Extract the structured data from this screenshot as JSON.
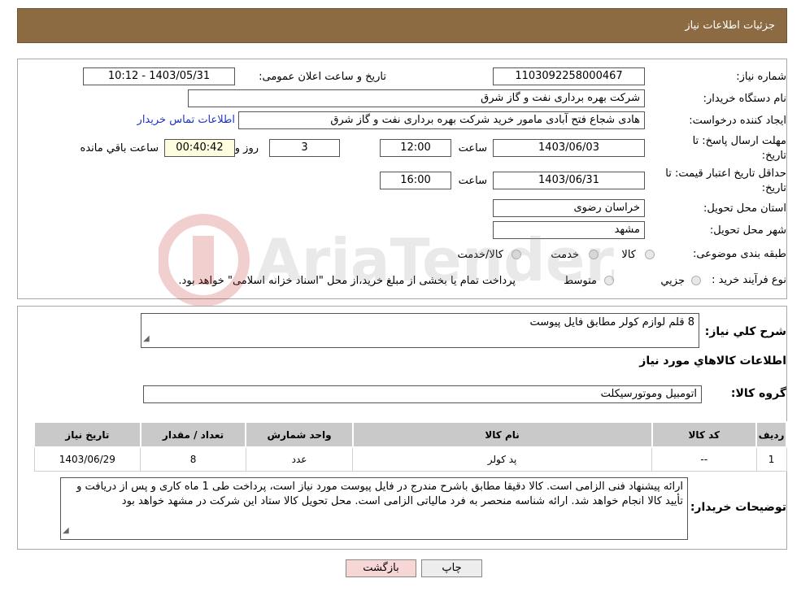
{
  "header": {
    "title": "جزئیات اطلاعات نیاز"
  },
  "form": {
    "need_number_label": "شماره نیاز:",
    "need_number": "1103092258000467",
    "announce_label": "تاریخ و ساعت اعلان عمومی:",
    "announce_value": "1403/05/31 - 10:12",
    "buyer_org_label": "نام دستگاه خریدار:",
    "buyer_org": "شرکت بهره برداری نفت و گاز شرق",
    "creator_label": "ایجاد کننده درخواست:",
    "creator": "هادی شجاع فتح آبادی مامور خرید شرکت بهره برداری نفت و گاز شرق",
    "contact_link": "اطلاعات تماس خریدار",
    "deadline_label_1": "مهلت ارسال پاسخ: تا",
    "deadline_label_2": "تاریخ:",
    "deadline_date": "1403/06/03",
    "time_word": "ساعت",
    "deadline_time": "12:00",
    "days_value": "3",
    "days_word": "روز و",
    "remaining_time": "00:40:42",
    "remaining_word": "ساعت باقي مانده",
    "validity_label_1": "حداقل تاریخ اعتبار قیمت: تا",
    "validity_label_2": "تاریخ:",
    "validity_date": "1403/06/31",
    "validity_time": "16:00",
    "province_label": "استان محل تحویل:",
    "province": "خراسان رضوی",
    "city_label": "شهر محل تحویل:",
    "city": "مشهد",
    "category_label": "طبقه بندی موضوعی:",
    "category_options": [
      "کالا",
      "خدمت",
      "کالا/خدمت"
    ],
    "process_label": "نوع فرآیند خرید :",
    "process_options": [
      "جزيي",
      "متوسط"
    ],
    "process_note": "پرداخت تمام یا بخشی از مبلغ خرید،از محل \"اسناد خزانه اسلامی\" خواهد بود."
  },
  "details": {
    "summary_label": "شرح کلي نياز:",
    "summary": "8 قلم لوازم کولر مطابق فایل پیوست",
    "items_title": "اطلاعات کالاهاي مورد نياز",
    "group_label": "گروه کالا:",
    "group": "اتومبیل وموتورسیکلت",
    "table_headers": [
      "رديف",
      "کد کالا",
      "نام کالا",
      "واحد شمارش",
      "تعداد / مقدار",
      "تاریخ نیاز"
    ],
    "rows": [
      [
        "1",
        "--",
        "پد کولر",
        "عدد",
        "8",
        "1403/06/29"
      ]
    ],
    "buyer_notes_label": "توضیحات خریدار:",
    "buyer_notes": "ارائه پیشنهاد فنی الزامی است. کالا دقیقا مطابق باشرح مندرج در فایل پیوست مورد نیاز است، پرداخت طی  1 ماه کاری و پس از دریافت و تأیید کالا انجام خواهد شد. ارائه شناسه منحصر به فرد مالیاتی الزامی است. محل تحویل کالا ستاد این شرکت در مشهد خواهد بود"
  },
  "buttons": {
    "print": "چاپ",
    "back": "بازگشت"
  },
  "colors": {
    "header": "#8c6b43",
    "link": "#1f33c9",
    "back_button": "#f7d6d6",
    "print_button": "#ededed"
  }
}
